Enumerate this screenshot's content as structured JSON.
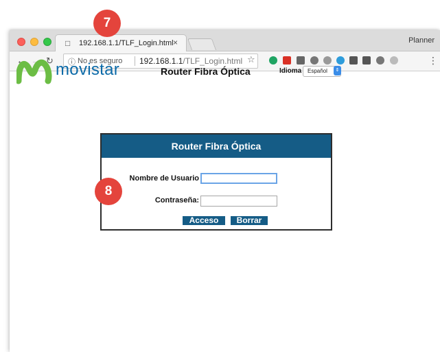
{
  "browser": {
    "tab_title": "192.168.1.1/TLF_Login.html",
    "tab_close": "×",
    "profile": "Planner",
    "omnibox": {
      "security_label": "No es seguro",
      "url_host": "192.168.1.1",
      "url_path": "/TLF_Login.html"
    }
  },
  "page": {
    "brand_name": "movistar",
    "header_title": "Router Fibra Óptica",
    "language_label": "Idioma",
    "language_value": "Español"
  },
  "login": {
    "panel_title": "Router Fibra Óptica",
    "username_label": "Nombre de Usuario",
    "username_value": "",
    "password_label": "Contraseña:",
    "password_value": "",
    "submit_label": "Acceso",
    "reset_label": "Borrar"
  },
  "annotations": {
    "badge_7": "7",
    "badge_8": "8"
  },
  "colors": {
    "brand_blue": "#0b6aa8",
    "brand_green": "#6cbd45",
    "panel_header": "#155c86",
    "badge_red": "#e4443c"
  },
  "icons": [
    "page-icon",
    "close-icon",
    "back-icon",
    "forward-icon",
    "reload-icon",
    "info-icon",
    "star-icon",
    "movistar-m-icon",
    "dropdown-arrow-icon"
  ]
}
